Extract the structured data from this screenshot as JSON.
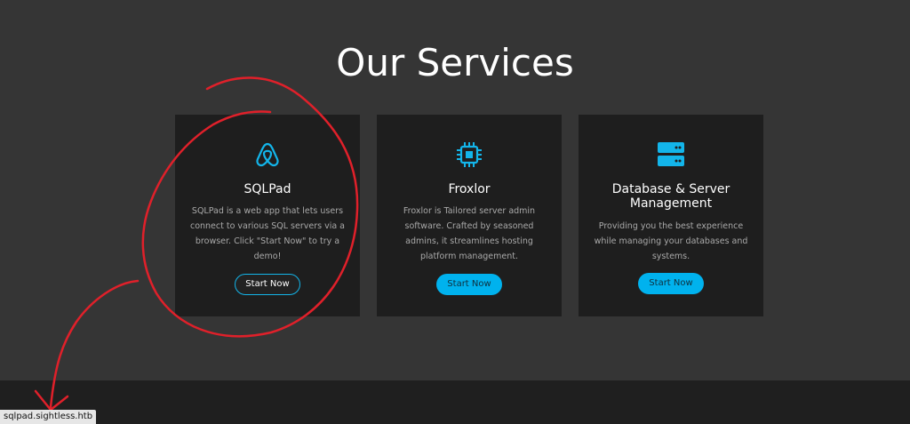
{
  "section": {
    "title": "Our Services"
  },
  "cards": [
    {
      "icon": "airbnb-logo-icon",
      "title": "SQLPad",
      "description": "SQLPad is a web app that lets users connect to various SQL servers via a browser. Click \"Start Now\" to try a demo!",
      "button_label": "Start Now"
    },
    {
      "icon": "cpu-chip-icon",
      "title": "Froxlor",
      "description": "Froxlor is Tailored server admin software. Crafted by seasoned admins, it streamlines hosting platform management.",
      "button_label": "Start Now"
    },
    {
      "icon": "server-icon",
      "title": "Database & Server Management",
      "description": "Providing you the best experience while managing your databases and systems.",
      "button_label": "Start Now"
    }
  ],
  "status_bar": {
    "url": "sqlpad.sightless.htb"
  },
  "colors": {
    "background": "#353535",
    "card": "#1e1e1e",
    "accent": "#00b2ee",
    "annotation": "#e0202a"
  }
}
